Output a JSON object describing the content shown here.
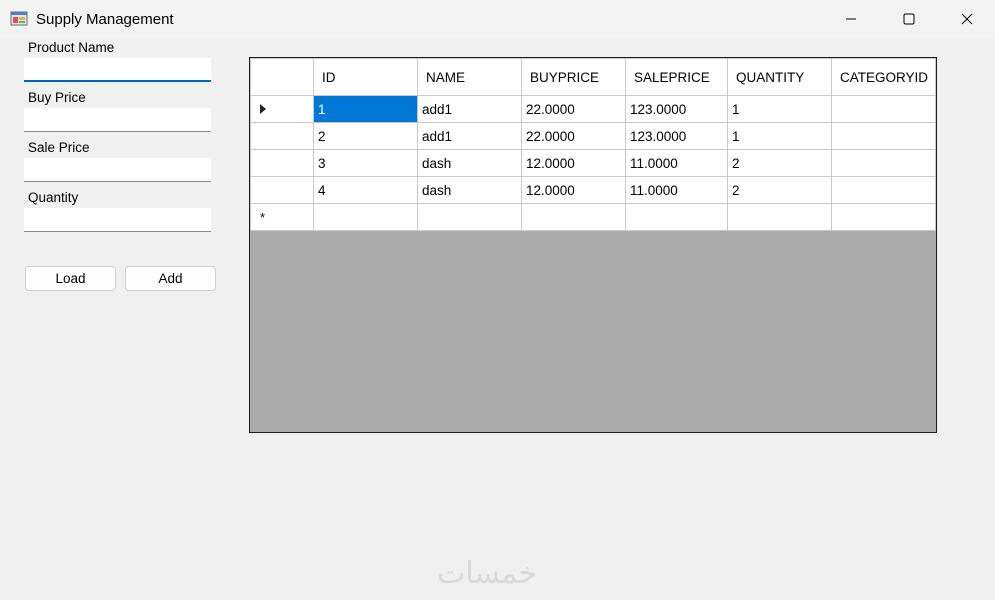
{
  "window": {
    "title": "Supply Management",
    "icon": "app-window-icon"
  },
  "form": {
    "product_name": {
      "label": "Product Name",
      "value": ""
    },
    "buy_price": {
      "label": "Buy Price",
      "value": ""
    },
    "sale_price": {
      "label": "Sale Price",
      "value": ""
    },
    "quantity": {
      "label": "Quantity",
      "value": ""
    },
    "load_label": "Load",
    "add_label": "Add"
  },
  "grid": {
    "columns": [
      "ID",
      "NAME",
      "BUYPRICE",
      "SALEPRICE",
      "QUANTITY",
      "CATEGORYID"
    ],
    "rows": [
      [
        "1",
        "add1",
        "22.0000",
        "123.0000",
        "1",
        ""
      ],
      [
        "2",
        "add1",
        "22.0000",
        "123.0000",
        "1",
        ""
      ],
      [
        "3",
        "dash",
        "12.0000",
        "11.0000",
        "2",
        ""
      ],
      [
        "4",
        "dash",
        "12.0000",
        "11.0000",
        "2",
        ""
      ]
    ],
    "new_row_marker": "*",
    "selection_color": "#0078d7"
  },
  "watermark": "خمسات"
}
